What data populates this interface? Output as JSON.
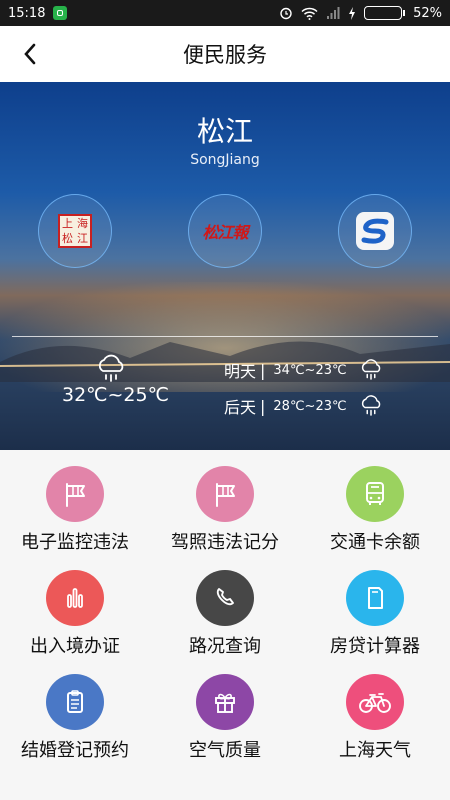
{
  "status_bar": {
    "time": "15:18",
    "battery": "52%",
    "battery_level": 0.52
  },
  "header": {
    "title": "便民服务",
    "back_icon": "chevron-left-icon"
  },
  "city": {
    "name": "松江",
    "pinyin": "SongJiang"
  },
  "quick_links": [
    {
      "icon": "shanghai-songjiang-seal-icon",
      "seal_text": [
        "上",
        "海",
        "松",
        "江"
      ]
    },
    {
      "icon": "songjiang-calligraphy-icon",
      "text": "松江報"
    },
    {
      "icon": "s-logo-icon"
    }
  ],
  "weather": {
    "today": {
      "icon": "rain-cloud-icon",
      "temp": "32℃~25℃"
    },
    "forecast": [
      {
        "day": "明天",
        "sep": "|",
        "temp": "34℃~23℃",
        "icon": "rain-cloud-icon"
      },
      {
        "day": "后天",
        "sep": "|",
        "temp": "28℃~23℃",
        "icon": "rain-cloud-icon"
      }
    ]
  },
  "services": [
    {
      "label": "电子监控违法",
      "icon": "windsock-icon",
      "color": "#e284a9"
    },
    {
      "label": "驾照违法记分",
      "icon": "windsock-icon",
      "color": "#e284a9"
    },
    {
      "label": "交通卡余额",
      "icon": "bus-icon",
      "color": "#9bd25f"
    },
    {
      "label": "出入境办证",
      "icon": "bar-chart-icon",
      "color": "#ec5858"
    },
    {
      "label": "路况查询",
      "icon": "phone-icon",
      "color": "#474747"
    },
    {
      "label": "房贷计算器",
      "icon": "document-icon",
      "color": "#2ab5ec"
    },
    {
      "label": "结婚登记预约",
      "icon": "clipboard-icon",
      "color": "#4a78c6"
    },
    {
      "label": "空气质量",
      "icon": "gift-icon",
      "color": "#8d47a6"
    },
    {
      "label": "上海天气",
      "icon": "bicycle-icon",
      "color": "#ee4f7c"
    }
  ]
}
